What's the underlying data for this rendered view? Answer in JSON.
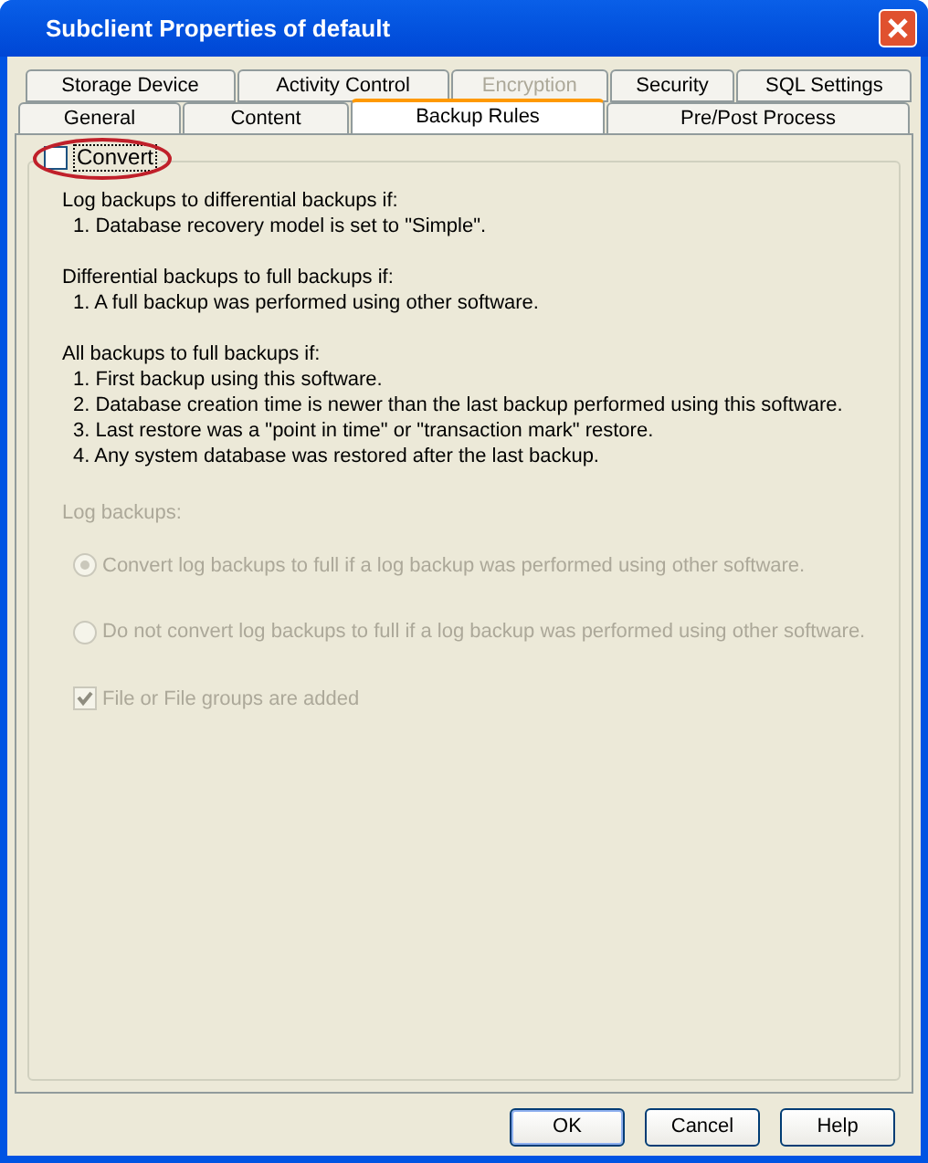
{
  "window": {
    "title": "Subclient Properties of default"
  },
  "tab_rows": [
    [
      {
        "label": "Storage Device",
        "selected": false,
        "disabled": false
      },
      {
        "label": "Activity Control",
        "selected": false,
        "disabled": false
      },
      {
        "label": "Encryption",
        "selected": false,
        "disabled": true
      },
      {
        "label": "Security",
        "selected": false,
        "disabled": false
      },
      {
        "label": "SQL Settings",
        "selected": false,
        "disabled": false
      }
    ],
    [
      {
        "label": "General",
        "selected": false,
        "disabled": false
      },
      {
        "label": "Content",
        "selected": false,
        "disabled": false
      },
      {
        "label": "Backup Rules",
        "selected": true,
        "disabled": false
      },
      {
        "label": "Pre/Post Process",
        "selected": false,
        "disabled": false
      }
    ]
  ],
  "convert": {
    "label": "Convert",
    "checked": false,
    "highlighted": true
  },
  "sections": [
    {
      "heading": "Log backups to differential backups if:",
      "items": [
        "1. Database recovery model is set to \"Simple\"."
      ]
    },
    {
      "heading": "Differential backups to full backups if:",
      "items": [
        "1. A full backup was performed using other software."
      ]
    },
    {
      "heading": "All backups to full backups if:",
      "items": [
        "1. First backup using this software.",
        "2. Database creation time is newer than the last backup performed using this software.",
        "3. Last restore was a \"point in time\" or \"transaction mark\" restore.",
        "4. Any system database was restored after the last backup."
      ]
    }
  ],
  "log_backups": {
    "label": "Log backups:",
    "disabled": true,
    "options": [
      {
        "kind": "radio",
        "label": "Convert log backups to full if a log backup was performed using other software.",
        "selected": true
      },
      {
        "kind": "radio",
        "label": "Do not convert log backups to full if a log backup was performed using other software.",
        "selected": false
      },
      {
        "kind": "checkbox",
        "label": "File or File groups are added",
        "selected": true
      }
    ]
  },
  "buttons": [
    {
      "label": "OK",
      "default": true
    },
    {
      "label": "Cancel",
      "default": false
    },
    {
      "label": "Help",
      "default": false
    }
  ]
}
